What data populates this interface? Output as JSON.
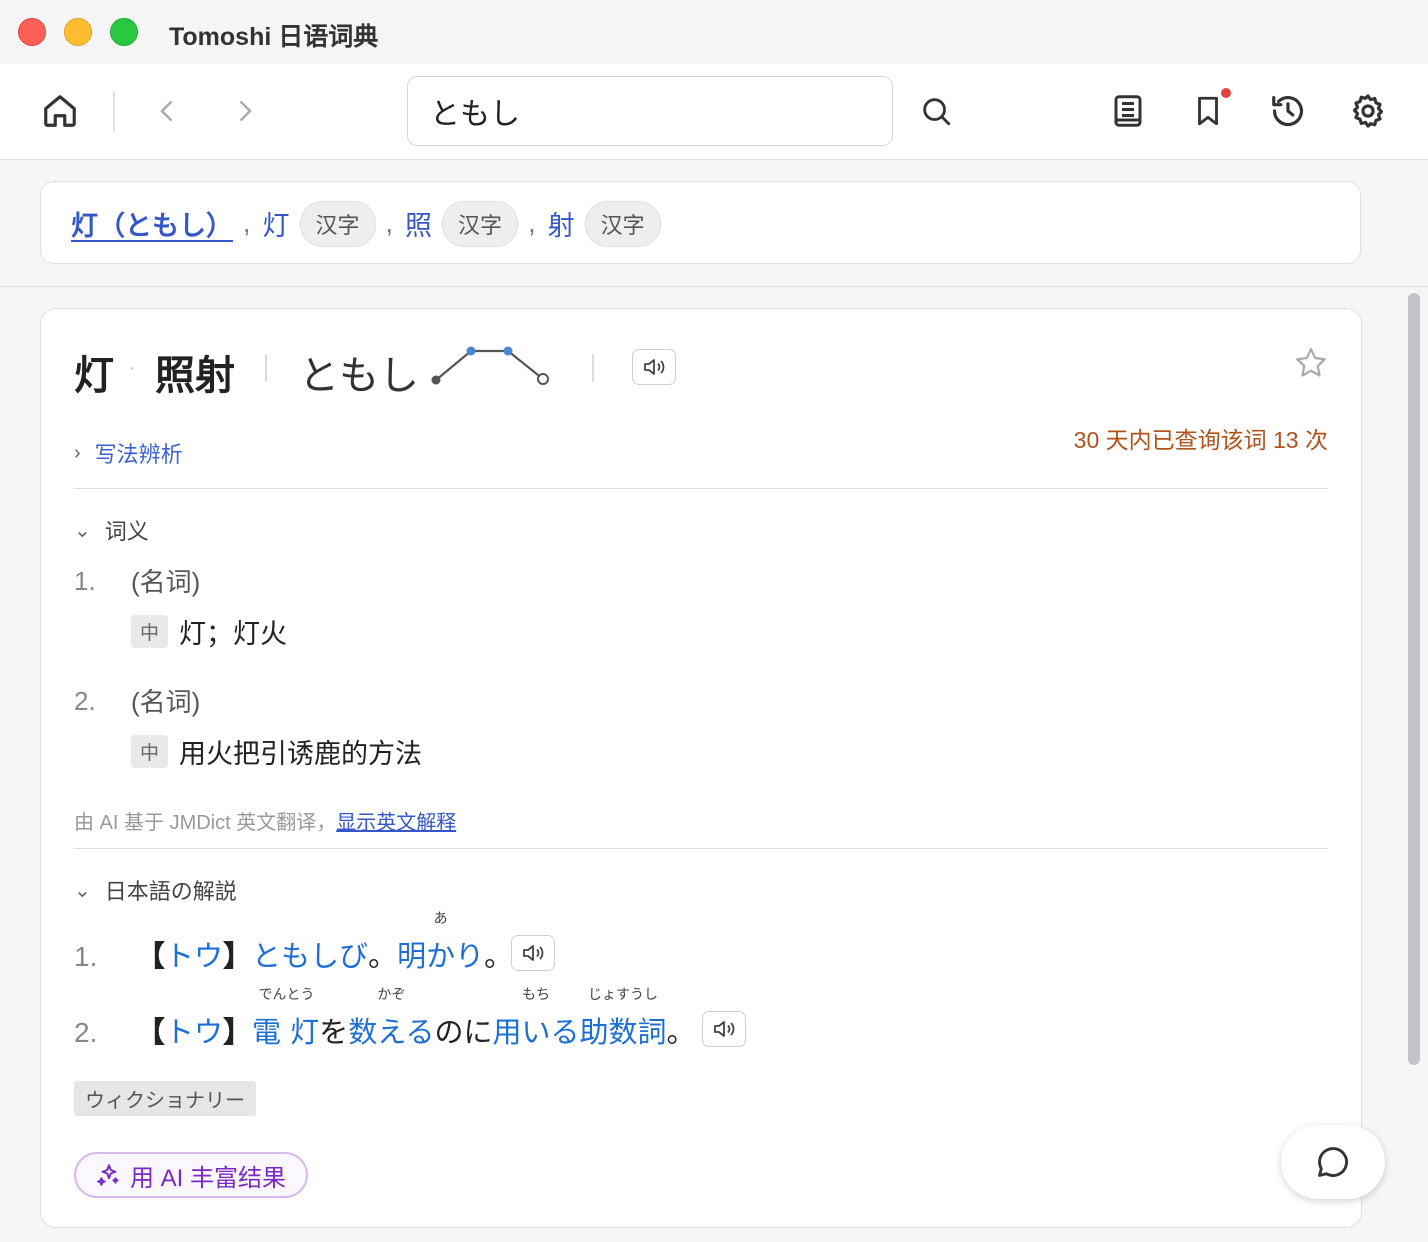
{
  "window": {
    "title": "Tomoshi 日语词典"
  },
  "search": {
    "query": "ともし"
  },
  "icons": {
    "home": "home-icon",
    "back": "chevron-left-icon",
    "forward": "chevron-right-icon",
    "search": "search-icon",
    "wordbook": "book-icon",
    "bookmark": "bookmark-icon",
    "history": "history-icon",
    "settings": "gear-icon",
    "star": "star-icon",
    "speaker": "speaker-icon",
    "chat": "chat-bubble-icon",
    "sparkle": "sparkle-icon"
  },
  "colors": {
    "accent": "#3657c9",
    "link": "#1c6fd6",
    "count": "#b0521b",
    "ai_purple": "#7a29c4",
    "notify_dot": "#e8413c"
  },
  "results": {
    "main": "灯（ともし）",
    "items": [
      {
        "kanji": "灯",
        "tag": "汉字"
      },
      {
        "kanji": "照",
        "tag": "汉字"
      },
      {
        "kanji": "射",
        "tag": "汉字"
      }
    ]
  },
  "entry": {
    "headword_1": "灯",
    "separator": "·",
    "headword_2": "照射",
    "reading": "ともし",
    "lookup_count_text": "30 天内已查询该词 13 次",
    "orthography_label": "写法辨析",
    "senses_title": "词义",
    "senses": [
      {
        "num": "1.",
        "pos": "(名词)",
        "lang": "中",
        "gloss": "灯；灯火"
      },
      {
        "num": "2.",
        "pos": "(名词)",
        "lang": "中",
        "gloss": "用火把引诱鹿的方法"
      }
    ],
    "ai_note": "由 AI 基于 JMDict 英文翻译，",
    "ai_note_link": "显示英文解释",
    "jp_title": "日本語の解説",
    "jp_defs": {
      "d1": {
        "num": "1.",
        "br_open": "【",
        "reading": "トウ",
        "br_close": "】",
        "w1": "ともしび",
        "p1": "。",
        "w2": "明かり",
        "w2_ruby": "あ",
        "p2": "。"
      },
      "d2": {
        "num": "2.",
        "br_open": "【",
        "reading": "トウ",
        "br_close": "】",
        "w1": "電",
        "w1_ruby": "でんとう",
        "w2": "灯",
        "t1": "を",
        "w3": "数える",
        "w3_ruby": "かぞ",
        "t2": "のに",
        "w4": "用いる",
        "w4_ruby": "もち",
        "w5": "助数詞",
        "w5_ruby": "じょすうし",
        "p": "。"
      }
    },
    "source_tag": "ウィクショナリー",
    "ai_button": "用 AI 丰富结果"
  }
}
